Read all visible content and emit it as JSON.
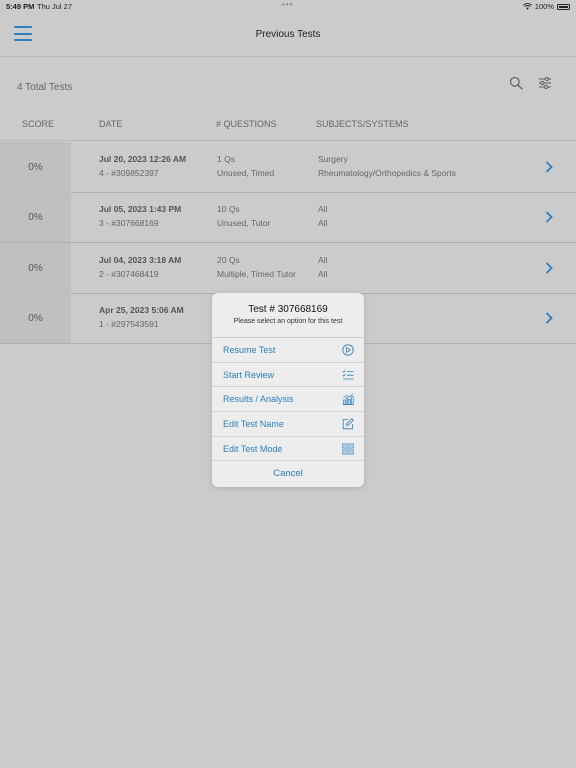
{
  "status_bar": {
    "time": "5:49 PM",
    "date": "Thu Jul 27",
    "battery": "100%"
  },
  "header": {
    "title": "Previous Tests"
  },
  "summary": {
    "total_label": "4 Total Tests"
  },
  "columns": {
    "score": "SCORE",
    "date": "DATE",
    "questions": "# QUESTIONS",
    "subjects": "SUBJECTS/SYSTEMS"
  },
  "rows": [
    {
      "score": "0%",
      "date": "Jul 20, 2023 12:26 AM",
      "id": "4 - #309852397",
      "q_count": "1 Qs",
      "mode": "Unused, Timed",
      "subject1": "Surgery",
      "subject2": "Rheumatology/Orthopedics & Sports"
    },
    {
      "score": "0%",
      "date": "Jul 05, 2023 1:43 PM",
      "id": "3 - #307668169",
      "q_count": "10 Qs",
      "mode": "Unused, Tutor",
      "subject1": "All",
      "subject2": "All"
    },
    {
      "score": "0%",
      "date": "Jul 04, 2023 3:18 AM",
      "id": "2 - #307468419",
      "q_count": "20 Qs",
      "mode": "Multiple, Timed Tutor",
      "subject1": "All",
      "subject2": "All"
    },
    {
      "score": "0%",
      "date": "Apr 25, 2023 5:06 AM",
      "id": "1 - #297543591",
      "q_count": "",
      "mode": "",
      "subject1": "",
      "subject2": ""
    }
  ],
  "popup": {
    "title": "Test # 307668169",
    "subtitle": "Please select an option for this test",
    "options": [
      {
        "label": "Resume Test",
        "icon": "play-circle-icon"
      },
      {
        "label": "Start Review",
        "icon": "checklist-icon"
      },
      {
        "label": "Results / Analysis",
        "icon": "bar-chart-icon"
      },
      {
        "label": "Edit Test Name",
        "icon": "edit-icon"
      },
      {
        "label": "Edit Test Mode",
        "icon": "mode-icon"
      }
    ],
    "cancel": "Cancel"
  },
  "colors": {
    "accent": "#2a7fc0",
    "background": "#cbcbcb",
    "score_bg": "#c0c0c0"
  }
}
